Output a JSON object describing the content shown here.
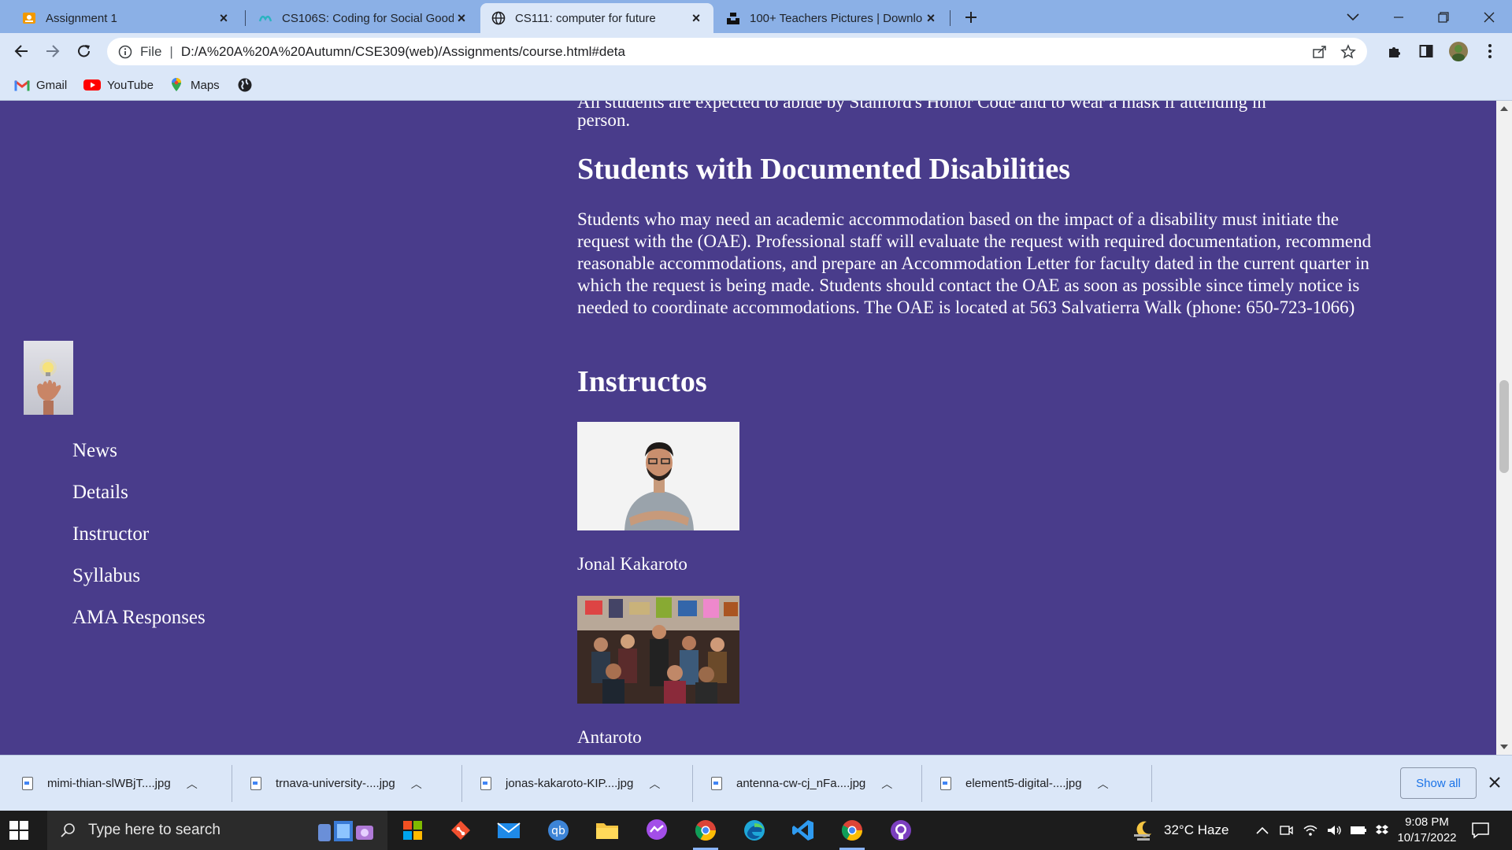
{
  "browser": {
    "tabs": [
      {
        "title": "Assignment 1",
        "active": false
      },
      {
        "title": "CS106S: Coding for Social Good",
        "active": false
      },
      {
        "title": "CS111: computer for future",
        "active": true
      },
      {
        "title": "100+ Teachers Pictures | Downlo",
        "active": false
      }
    ],
    "address": {
      "scheme": "File",
      "url": "D:/A%20A%20A%20Autumn/CSE309(web)/Assignments/course.html#deta"
    },
    "bookmarks": [
      {
        "label": "Gmail"
      },
      {
        "label": "YouTube"
      },
      {
        "label": "Maps"
      }
    ]
  },
  "page": {
    "cut_text": "All students are expected to abide by Stanford's Honor Code and to wear a mask if attending in",
    "cut_text_end": "person.",
    "nav": [
      "News",
      "Details",
      "Instructor",
      "Syllabus",
      "AMA Responses"
    ],
    "section_disabilities": {
      "heading": "Students with Documented Disabilities",
      "body": "Students who may need an academic accommodation based on the impact of a disability must initiate the request with the (OAE). Professional staff will evaluate the request with required documentation, recommend reasonable accommodations, and prepare an Accommodation Letter for faculty dated in the current quarter in which the request is being made. Students should contact the OAE as soon as possible since timely notice is needed to coordinate accommodations. The OAE is located at 563 Salvatierra Walk (phone: 650-723-1066)"
    },
    "section_instructors": {
      "heading": "Instructos",
      "people": [
        {
          "name": "Jonal Kakaroto"
        },
        {
          "name": "Antaroto"
        }
      ]
    },
    "colors": {
      "page_bg": "#493c8b",
      "text": "#ffffff"
    }
  },
  "downloads": {
    "items": [
      {
        "file": "mimi-thian-slWBjT....jpg"
      },
      {
        "file": "trnava-university-....jpg"
      },
      {
        "file": "jonas-kakaroto-KIP....jpg"
      },
      {
        "file": "antenna-cw-cj_nFa....jpg"
      },
      {
        "file": "element5-digital-....jpg"
      }
    ],
    "show_all": "Show all"
  },
  "taskbar": {
    "search_placeholder": "Type here to search",
    "weather": "32°C  Haze",
    "time": "9:08 PM",
    "date": "10/17/2022"
  }
}
